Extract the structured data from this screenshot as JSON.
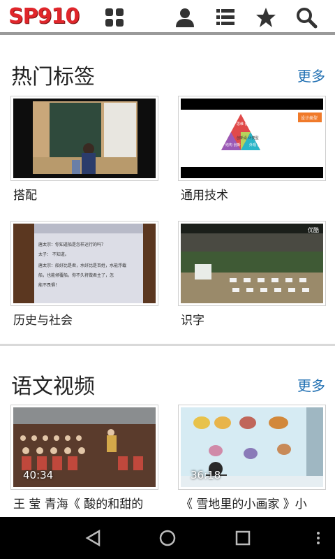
{
  "app": {
    "logo_text": "SP910"
  },
  "toolbar": {
    "icons": [
      "grid-icon",
      "user-icon",
      "list-icon",
      "star-icon",
      "search-icon"
    ]
  },
  "sections": [
    {
      "title": "热门标签",
      "more_label": "更多",
      "items": [
        {
          "caption": "搭配",
          "overlay": ""
        },
        {
          "caption": "通用技术",
          "overlay": ""
        },
        {
          "caption": "历史与社会",
          "overlay": ""
        },
        {
          "caption": "识字",
          "overlay": "优酷"
        }
      ]
    },
    {
      "title": "语文视频",
      "more_label": "更多",
      "items": [
        {
          "caption": "王 莹 青海《 酸的和甜的",
          "duration": "40:34"
        },
        {
          "caption": "《 雪地里的小画家 》小",
          "duration": "36:18"
        }
      ]
    }
  ],
  "thumb_texts": {
    "pyramid_top": "思维 创新",
    "pyramid_center": "创新设 计类型",
    "pyramid_left": "结构 创新",
    "pyramid_right": "外观 创新",
    "slide_tag": "设计类型",
    "doc_line1": "唐太宗：你知道船是怎样运行的吗？",
    "doc_line2": "太子：  不知道。",
    "doc_line3": "唐太宗：船好比是君，水好比是百姓，水能浮载",
    "doc_line4": "船，也能倾覆船。你不久将做君主了，怎",
    "doc_line5": "能不畏惧！"
  },
  "colors": {
    "accent": "#1f6fb2",
    "logo": "#e0262b",
    "navbar": "#000000"
  },
  "navbar": {
    "icons": [
      "back-icon",
      "home-icon",
      "recents-icon",
      "menu-dots-icon"
    ]
  }
}
